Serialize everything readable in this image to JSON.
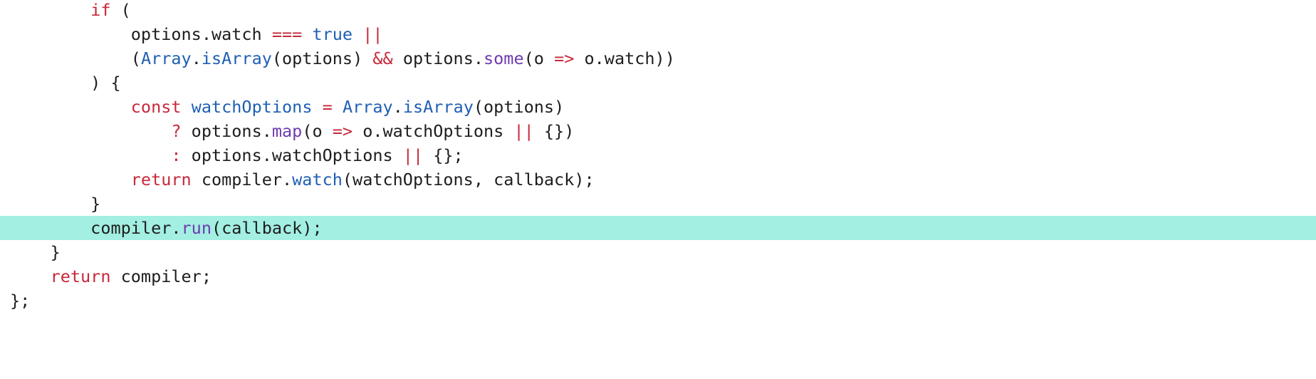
{
  "editor": {
    "highlight_color": "#a3efe2",
    "token_colors": {
      "keyword": "#c7283a",
      "operator": "#c7283a",
      "literal": "#1f5fb3",
      "builtin": "#1f5fb3",
      "method": "#6f3bb0",
      "def": "#1f5fb3",
      "plain": "#1d1d1d"
    },
    "lines": [
      {
        "highlighted": false,
        "tokens": [
          {
            "t": "        ",
            "k": "plain"
          },
          {
            "t": "if",
            "k": "keyword"
          },
          {
            "t": " (",
            "k": "punct"
          }
        ]
      },
      {
        "highlighted": false,
        "tokens": [
          {
            "t": "            options.watch ",
            "k": "plain"
          },
          {
            "t": "===",
            "k": "operator"
          },
          {
            "t": " ",
            "k": "plain"
          },
          {
            "t": "true",
            "k": "literal"
          },
          {
            "t": " ",
            "k": "plain"
          },
          {
            "t": "||",
            "k": "operator"
          }
        ]
      },
      {
        "highlighted": false,
        "tokens": [
          {
            "t": "            (",
            "k": "punct"
          },
          {
            "t": "Array",
            "k": "builtin"
          },
          {
            "t": ".",
            "k": "punct"
          },
          {
            "t": "isArray",
            "k": "builtin"
          },
          {
            "t": "(options) ",
            "k": "plain"
          },
          {
            "t": "&&",
            "k": "operator"
          },
          {
            "t": " options.",
            "k": "plain"
          },
          {
            "t": "some",
            "k": "method"
          },
          {
            "t": "(o ",
            "k": "plain"
          },
          {
            "t": "=>",
            "k": "operator"
          },
          {
            "t": " o.watch))",
            "k": "plain"
          }
        ]
      },
      {
        "highlighted": false,
        "tokens": [
          {
            "t": "        ) {",
            "k": "punct"
          }
        ]
      },
      {
        "highlighted": false,
        "tokens": [
          {
            "t": "            ",
            "k": "plain"
          },
          {
            "t": "const",
            "k": "keyword"
          },
          {
            "t": " ",
            "k": "plain"
          },
          {
            "t": "watchOptions",
            "k": "def"
          },
          {
            "t": " ",
            "k": "plain"
          },
          {
            "t": "=",
            "k": "operator"
          },
          {
            "t": " ",
            "k": "plain"
          },
          {
            "t": "Array",
            "k": "builtin"
          },
          {
            "t": ".",
            "k": "punct"
          },
          {
            "t": "isArray",
            "k": "builtin"
          },
          {
            "t": "(options)",
            "k": "plain"
          }
        ]
      },
      {
        "highlighted": false,
        "tokens": [
          {
            "t": "                ",
            "k": "plain"
          },
          {
            "t": "?",
            "k": "operator"
          },
          {
            "t": " options.",
            "k": "plain"
          },
          {
            "t": "map",
            "k": "method"
          },
          {
            "t": "(o ",
            "k": "plain"
          },
          {
            "t": "=>",
            "k": "operator"
          },
          {
            "t": " o.watchOptions ",
            "k": "plain"
          },
          {
            "t": "||",
            "k": "operator"
          },
          {
            "t": " {})",
            "k": "plain"
          }
        ]
      },
      {
        "highlighted": false,
        "tokens": [
          {
            "t": "                ",
            "k": "plain"
          },
          {
            "t": ":",
            "k": "operator"
          },
          {
            "t": " options.watchOptions ",
            "k": "plain"
          },
          {
            "t": "||",
            "k": "operator"
          },
          {
            "t": " {};",
            "k": "plain"
          }
        ]
      },
      {
        "highlighted": false,
        "tokens": [
          {
            "t": "            ",
            "k": "plain"
          },
          {
            "t": "return",
            "k": "keyword"
          },
          {
            "t": " compiler.",
            "k": "plain"
          },
          {
            "t": "watch",
            "k": "builtin"
          },
          {
            "t": "(watchOptions, callback);",
            "k": "plain"
          }
        ]
      },
      {
        "highlighted": false,
        "tokens": [
          {
            "t": "        }",
            "k": "punct"
          }
        ]
      },
      {
        "highlighted": true,
        "tokens": [
          {
            "t": "        compiler.",
            "k": "plain"
          },
          {
            "t": "run",
            "k": "method"
          },
          {
            "t": "(callback);",
            "k": "plain"
          }
        ]
      },
      {
        "highlighted": false,
        "tokens": [
          {
            "t": "    }",
            "k": "punct"
          }
        ]
      },
      {
        "highlighted": false,
        "tokens": [
          {
            "t": "    ",
            "k": "plain"
          },
          {
            "t": "return",
            "k": "keyword"
          },
          {
            "t": " compiler;",
            "k": "plain"
          }
        ]
      },
      {
        "highlighted": false,
        "tokens": [
          {
            "t": "};",
            "k": "punct"
          }
        ]
      }
    ]
  }
}
